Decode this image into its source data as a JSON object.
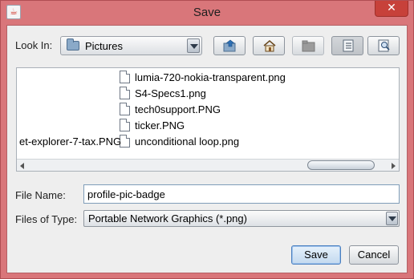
{
  "window": {
    "title": "Save",
    "app_icon": "java-icon",
    "close_glyph": "✕"
  },
  "look_in": {
    "label": "Look In:",
    "value": "Pictures"
  },
  "toolbar": {
    "buttons": [
      "up-one-level-icon",
      "home-icon",
      "new-folder-icon",
      "list-view-icon",
      "details-view-icon"
    ]
  },
  "files": {
    "items": [
      "lumia-720-nokia-transparent.png",
      "S4-Specs1.png",
      "tech0support.PNG",
      "ticker.PNG",
      "unconditional loop.png",
      "et-explorer-7-tax.PNG"
    ]
  },
  "file_name": {
    "label": "File Name:",
    "value": "profile-pic-badge"
  },
  "files_of_type": {
    "label": "Files of Type:",
    "value": "Portable Network Graphics (*.png)"
  },
  "actions": {
    "save": "Save",
    "cancel": "Cancel"
  },
  "colors": {
    "frame": "#d9767a",
    "close": "#c7413a",
    "default_button_border": "#4a7fbf"
  }
}
